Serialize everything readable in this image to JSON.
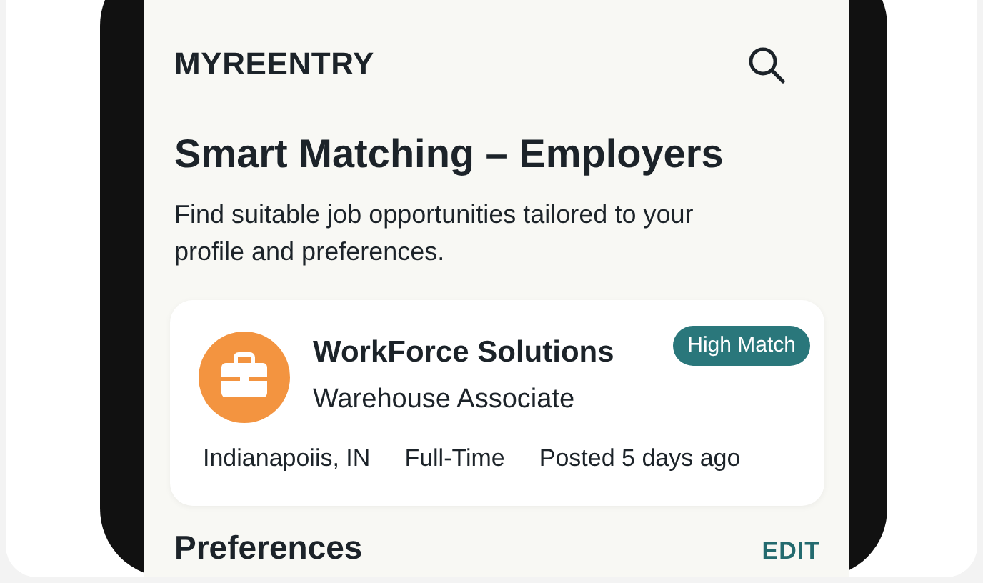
{
  "app": {
    "title": "MYREENTRY"
  },
  "page": {
    "heading": "Smart Matching – Employers",
    "subtitle": "Find suitable job opportunities tailored to your profile and preferences."
  },
  "matches": [
    {
      "company": "WorkForce Solutions",
      "job_title": "Warehouse Associate",
      "badge": "High Match",
      "location": "Indianapoiis, IN",
      "type": "Full-Time",
      "posted": "Posted 5 days ago"
    }
  ],
  "preferences": {
    "title": "Preferences",
    "action": "EDIT"
  }
}
